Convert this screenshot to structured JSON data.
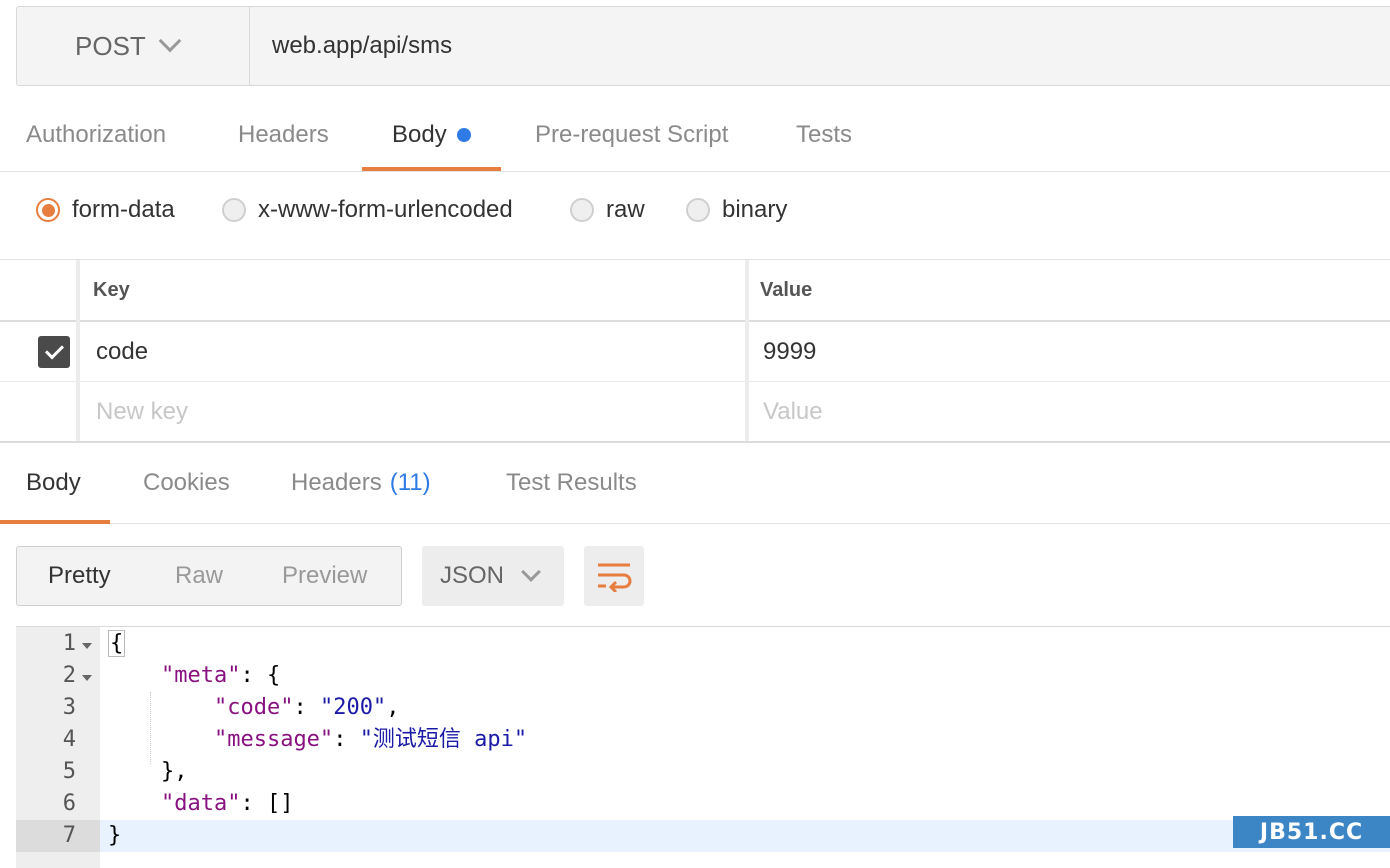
{
  "request": {
    "method": "POST",
    "url": "web.app/api/sms"
  },
  "request_tabs": [
    {
      "label": "Authorization"
    },
    {
      "label": "Headers"
    },
    {
      "label": "Body",
      "active": true,
      "modified_dot": true
    },
    {
      "label": "Pre-request Script"
    },
    {
      "label": "Tests"
    }
  ],
  "body_types": [
    {
      "label": "form-data",
      "selected": true
    },
    {
      "label": "x-www-form-urlencoded"
    },
    {
      "label": "raw"
    },
    {
      "label": "binary"
    }
  ],
  "form_table": {
    "headers": {
      "key": "Key",
      "value": "Value"
    },
    "rows": [
      {
        "checked": true,
        "key": "code",
        "value": "9999"
      }
    ],
    "new_row": {
      "key_placeholder": "New key",
      "value_placeholder": "Value"
    }
  },
  "response_tabs": [
    {
      "label": "Body",
      "active": true
    },
    {
      "label": "Cookies"
    },
    {
      "label": "Headers",
      "count": "(11)"
    },
    {
      "label": "Test Results"
    }
  ],
  "view_modes": [
    {
      "label": "Pretty",
      "active": true
    },
    {
      "label": "Raw"
    },
    {
      "label": "Preview"
    }
  ],
  "format": "JSON",
  "code_lines": [
    {
      "n": "1",
      "text": "{"
    },
    {
      "n": "2",
      "key": "\"meta\"",
      "rest": ": {"
    },
    {
      "n": "3",
      "key": "\"code\"",
      "sep": ": ",
      "val": "\"200\"",
      "tail": ","
    },
    {
      "n": "4",
      "key": "\"message\"",
      "sep": ": ",
      "val": "\"测试短信 api\""
    },
    {
      "n": "5",
      "text": "},"
    },
    {
      "n": "6",
      "key": "\"data\"",
      "rest": ": []"
    },
    {
      "n": "7",
      "text": "}"
    }
  ],
  "watermark": "JB51.CC",
  "colors": {
    "accent": "#e77d3f",
    "blue": "#2f7be6",
    "json_key": "#881280",
    "json_string": "#1a1aa6"
  }
}
